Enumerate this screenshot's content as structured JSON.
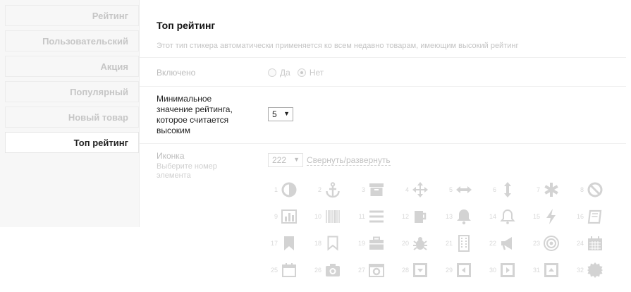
{
  "sidebar": {
    "items": [
      {
        "label": "Рейтинг"
      },
      {
        "label": "Пользовательский"
      },
      {
        "label": "Акция"
      },
      {
        "label": "Популярный"
      },
      {
        "label": "Новый товар"
      },
      {
        "label": "Топ рейтинг",
        "active": true
      }
    ]
  },
  "main": {
    "title": "Топ рейтинг",
    "description": "Этот тип стикера автоматически применяется ко всем недавно товарам, имеющим высокий рейтинг"
  },
  "enabled": {
    "label": "Включено",
    "option_yes": "Да",
    "option_no": "Нет",
    "selected": "Нет"
  },
  "min_rating": {
    "label_line1": "Минимальное",
    "label_line2": "значение рейтинга,",
    "label_line3": "которое считается",
    "label_line4": "высоким",
    "value": "5"
  },
  "icon_field": {
    "label": "Иконка",
    "hint_line1": "Выберите номер",
    "hint_line2": "элемента",
    "value": "222",
    "toggle_link": "Свернуть/развернуть"
  },
  "icons": [
    {
      "n": "1",
      "name": "half-circle-icon"
    },
    {
      "n": "2",
      "name": "anchor-icon"
    },
    {
      "n": "3",
      "name": "archive-box-icon"
    },
    {
      "n": "4",
      "name": "move-arrows-icon"
    },
    {
      "n": "5",
      "name": "horizontal-arrows-icon"
    },
    {
      "n": "6",
      "name": "vertical-arrows-icon"
    },
    {
      "n": "7",
      "name": "asterisk-icon"
    },
    {
      "n": "8",
      "name": "ban-icon"
    },
    {
      "n": "9",
      "name": "bar-chart-icon"
    },
    {
      "n": "10",
      "name": "barcode-icon"
    },
    {
      "n": "11",
      "name": "list-lines-icon"
    },
    {
      "n": "12",
      "name": "beer-mug-icon"
    },
    {
      "n": "13",
      "name": "bell-filled-icon"
    },
    {
      "n": "14",
      "name": "bell-outline-icon"
    },
    {
      "n": "15",
      "name": "lightning-bolt-icon"
    },
    {
      "n": "16",
      "name": "book-icon"
    },
    {
      "n": "17",
      "name": "bookmark-filled-icon"
    },
    {
      "n": "18",
      "name": "bookmark-outline-icon"
    },
    {
      "n": "19",
      "name": "briefcase-icon"
    },
    {
      "n": "20",
      "name": "bug-icon"
    },
    {
      "n": "21",
      "name": "building-icon"
    },
    {
      "n": "22",
      "name": "megaphone-icon"
    },
    {
      "n": "23",
      "name": "bullseye-icon"
    },
    {
      "n": "24",
      "name": "calendar-icon"
    },
    {
      "n": "25",
      "name": "calendar-outline-icon"
    },
    {
      "n": "26",
      "name": "camera-icon"
    },
    {
      "n": "27",
      "name": "camera-retro-icon"
    },
    {
      "n": "28",
      "name": "caret-square-down-icon"
    },
    {
      "n": "29",
      "name": "caret-square-left-icon"
    },
    {
      "n": "30",
      "name": "caret-square-right-icon"
    },
    {
      "n": "31",
      "name": "caret-square-up-icon"
    },
    {
      "n": "32",
      "name": "certificate-icon"
    }
  ]
}
